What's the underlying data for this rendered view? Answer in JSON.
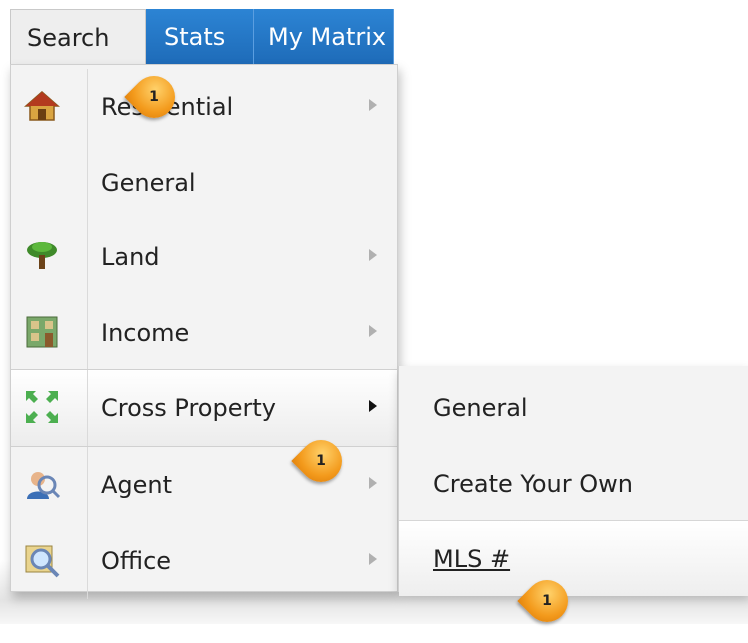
{
  "menubar": {
    "tabs": [
      {
        "label": "Search"
      },
      {
        "label": "Stats"
      },
      {
        "label": "My Matrix"
      }
    ]
  },
  "search_menu": {
    "items": [
      {
        "label": "Residential",
        "icon": "house-icon",
        "has_submenu": true
      },
      {
        "label": "General",
        "icon": "",
        "has_submenu": false
      },
      {
        "label": "Land",
        "icon": "tree-icon",
        "has_submenu": true
      },
      {
        "label": "Income",
        "icon": "building-icon",
        "has_submenu": true
      },
      {
        "label": "Cross Property",
        "icon": "arrows-icon",
        "has_submenu": true
      },
      {
        "label": "Agent",
        "icon": "agent-search-icon",
        "has_submenu": true
      },
      {
        "label": "Office",
        "icon": "office-search-icon",
        "has_submenu": true
      }
    ]
  },
  "cross_property_submenu": {
    "items": [
      {
        "label": "General"
      },
      {
        "label": "Create Your Own"
      },
      {
        "label": "MLS #"
      }
    ]
  },
  "callouts": [
    {
      "number": "1"
    },
    {
      "number": "1"
    },
    {
      "number": "1"
    }
  ],
  "colors": {
    "tab_blue": "#1e6bb8",
    "badge_orange": "#f39a1c"
  }
}
